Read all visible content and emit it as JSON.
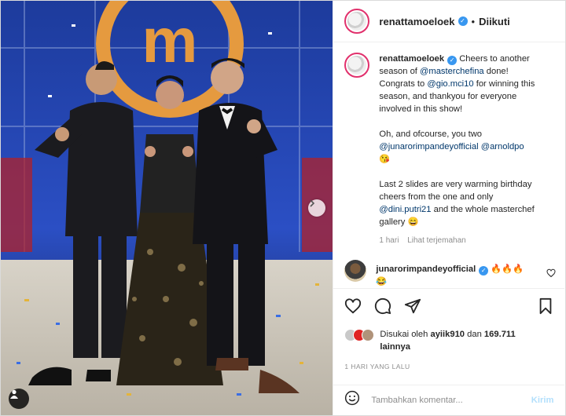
{
  "post": {
    "author": "renattamoeloek",
    "follow_status": "Diikuti",
    "separator": "•"
  },
  "caption": {
    "username": "renattamoeloek",
    "p1_a": " Cheers to another season of ",
    "p1_mention1": "@masterchefina",
    "p1_b": " done! Congrats to ",
    "p1_mention2": "@gio.mci10",
    "p1_c": " for winning this season, and thankyou for everyone involved in this show!",
    "p2_a": "Oh, and ofcourse, you two ",
    "p2_mention1": "@junarorimpandeyofficial",
    "p2_mention2": "@arnoldpo",
    "p2_emoji": "😘",
    "p3_a": "Last 2 slides are very warming birthday cheers from the one and only ",
    "p3_mention": "@dini.putri21",
    "p3_b": " and the whole masterchef gallery ",
    "p3_emoji": "😄",
    "time": "1 hari",
    "see_translation": "Lihat terjemahan"
  },
  "reply": {
    "username": "junarorimpandeyofficial",
    "text_line1": "🔥🔥🔥",
    "text_line2": "😂"
  },
  "likes": {
    "prefix": "Disukai oleh ",
    "user": "ayiik910",
    "middle": " dan ",
    "count": "169.711",
    "suffix": "lainnya"
  },
  "timestamp": "1 HARI YANG LALU",
  "add_comment": {
    "emoji_icon": "smiley-icon",
    "placeholder": "Tambahkan komentar...",
    "send_label": "Kirim"
  },
  "colors": {
    "accent": "#3897f0",
    "mention": "#00376b",
    "send_disabled": "#b2dffc"
  }
}
